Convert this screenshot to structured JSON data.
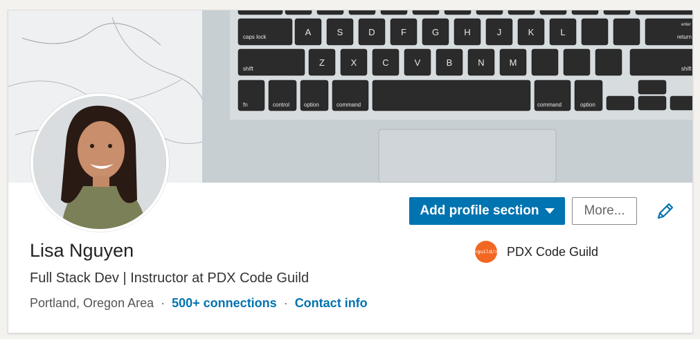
{
  "profile": {
    "name": "Lisa Nguyen",
    "headline": "Full Stack Dev | Instructor at PDX Code Guild",
    "location": "Portland, Oregon Area",
    "separator": "·",
    "connections_link": "500+ connections",
    "contact_link": "Contact info"
  },
  "actions": {
    "add_section_label": "Add profile section",
    "more_label": "More...",
    "edit_icon": "pencil-icon"
  },
  "company": {
    "name": "PDX Code Guild",
    "logo_text": "<guild/>"
  },
  "banner": {
    "keys_row1": [
      "A",
      "S",
      "D",
      "F",
      "G",
      "H",
      "J",
      "K",
      "L"
    ],
    "keys_row2": [
      "Z",
      "X",
      "C",
      "V",
      "B",
      "N",
      "M"
    ],
    "caps_lock": "caps lock",
    "shift": "shift",
    "fn": "fn",
    "control": "control",
    "option": "option",
    "command": "command",
    "return": "return",
    "enter": "enter"
  },
  "colors": {
    "accent": "#0073b1",
    "logo": "#f26822"
  }
}
